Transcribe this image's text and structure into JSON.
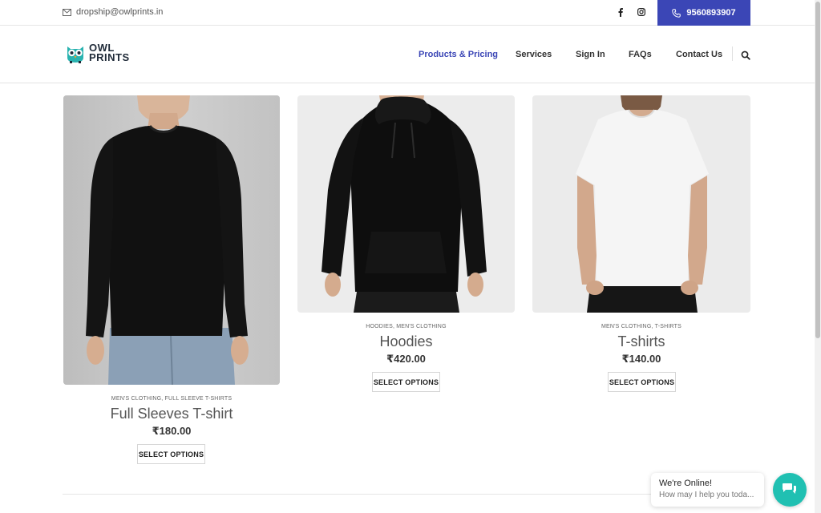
{
  "topbar": {
    "email": "dropship@owlprints.in",
    "social_icons": [
      "facebook-icon",
      "instagram-icon"
    ],
    "phone": "9560893907",
    "phone_bg": "#3b46b6"
  },
  "header": {
    "logo_line1": "OWL",
    "logo_line2": "PRINTS",
    "nav": [
      {
        "label": "Products & Pricing",
        "active": true
      },
      {
        "label": "Services"
      },
      {
        "label": "Sign In"
      },
      {
        "label": "FAQs"
      },
      {
        "label": "Contact Us"
      }
    ],
    "accent": "#3b46b6"
  },
  "products": [
    {
      "categories": "MEN'S CLOTHING, FULL SLEEVE T-SHIRTS",
      "title": "Full Sleeves T-shirt",
      "price": "₹180.00",
      "button": "SELECT OPTIONS"
    },
    {
      "categories": "HOODIES, MEN'S CLOTHING",
      "title": "Hoodies",
      "price": "₹420.00",
      "button": "SELECT OPTIONS"
    },
    {
      "categories": "MEN'S CLOTHING, T-SHIRTS",
      "title": "T-shirts",
      "price": "₹140.00",
      "button": "SELECT OPTIONS"
    }
  ],
  "chat": {
    "line1": "We're Online!",
    "line2": "How may I help you toda...",
    "color": "#20c0b2"
  }
}
